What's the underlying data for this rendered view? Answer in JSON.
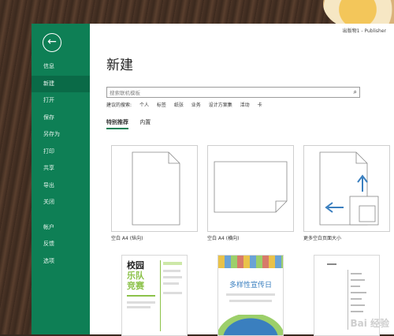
{
  "window": {
    "title": "出版物1 - Publisher"
  },
  "sidebar": {
    "back_icon": "back-arrow-icon",
    "items": [
      {
        "label": "信息"
      },
      {
        "label": "新建",
        "active": true
      },
      {
        "label": "打开"
      },
      {
        "label": "保存"
      },
      {
        "label": "另存为"
      },
      {
        "label": "打印"
      },
      {
        "label": "共享"
      },
      {
        "label": "导出"
      },
      {
        "label": "关闭"
      },
      {
        "label": "帐户"
      },
      {
        "label": "反馈"
      },
      {
        "label": "选项"
      }
    ]
  },
  "main": {
    "heading": "新建",
    "search": {
      "placeholder": "搜索联机模板"
    },
    "suggested_label": "建议的搜索:",
    "suggested": [
      "个人",
      "标签",
      "纸张",
      "业务",
      "设计方案集",
      "活动",
      "卡"
    ],
    "tabs": [
      {
        "label": "特别推荐",
        "active": true
      },
      {
        "label": "内置"
      }
    ],
    "templates": [
      {
        "label": "空白 A4 (纵向)"
      },
      {
        "label": "空白 A4 (横向)"
      },
      {
        "label": "更多空白页面大小"
      }
    ],
    "posters": {
      "p1": {
        "line1": "校园",
        "line2": "乐队",
        "line3": "竞赛"
      },
      "p2": {
        "title": "多样性宣传日"
      }
    }
  },
  "watermark": "Bai 经验",
  "colors": {
    "accent": "#0e7f55",
    "accent_dark": "#0a6a47",
    "poster_green": "#8cc24a",
    "poster_blue": "#3a7fbf"
  }
}
